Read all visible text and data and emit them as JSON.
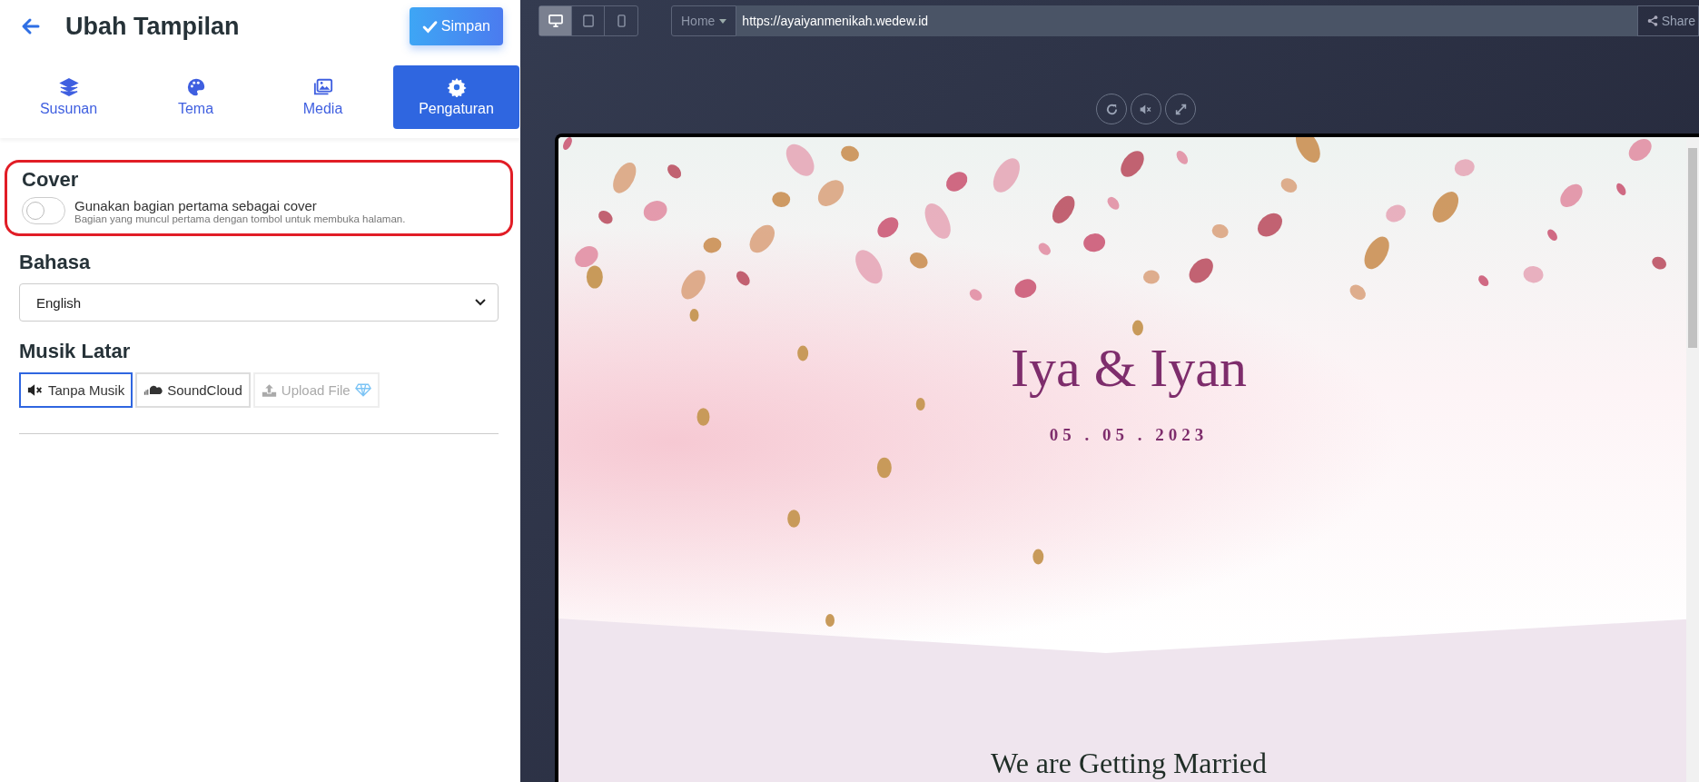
{
  "header": {
    "title": "Ubah Tampilan",
    "save_button": "Simpan"
  },
  "tabs": [
    {
      "label": "Susunan",
      "selected": false
    },
    {
      "label": "Tema",
      "selected": false
    },
    {
      "label": "Media",
      "selected": false
    },
    {
      "label": "Pengaturan",
      "selected": true
    }
  ],
  "cover": {
    "heading": "Cover",
    "toggle_label": "Gunakan bagian pertama sebagai cover",
    "toggle_hint": "Bagian yang muncul pertama dengan tombol untuk membuka halaman.",
    "on": false
  },
  "language": {
    "heading": "Bahasa",
    "value": "English"
  },
  "music": {
    "heading": "Musik Latar",
    "options": [
      {
        "label": "Tanpa Musik",
        "selected": true,
        "disabled": false
      },
      {
        "label": "SoundCloud",
        "selected": false,
        "disabled": false
      },
      {
        "label": "Upload File",
        "selected": false,
        "disabled": true
      }
    ]
  },
  "preview_toolbar": {
    "devices": [
      {
        "selected": true
      },
      {
        "selected": false
      },
      {
        "selected": false
      }
    ],
    "page_select": "Home",
    "url": "https://ayaiyanmenikah.wedew.id",
    "share": "Share"
  },
  "invitation": {
    "names": "Iya & Iyan",
    "date": "05 . 05 . 2023",
    "subtitle": "We are Getting Married"
  }
}
